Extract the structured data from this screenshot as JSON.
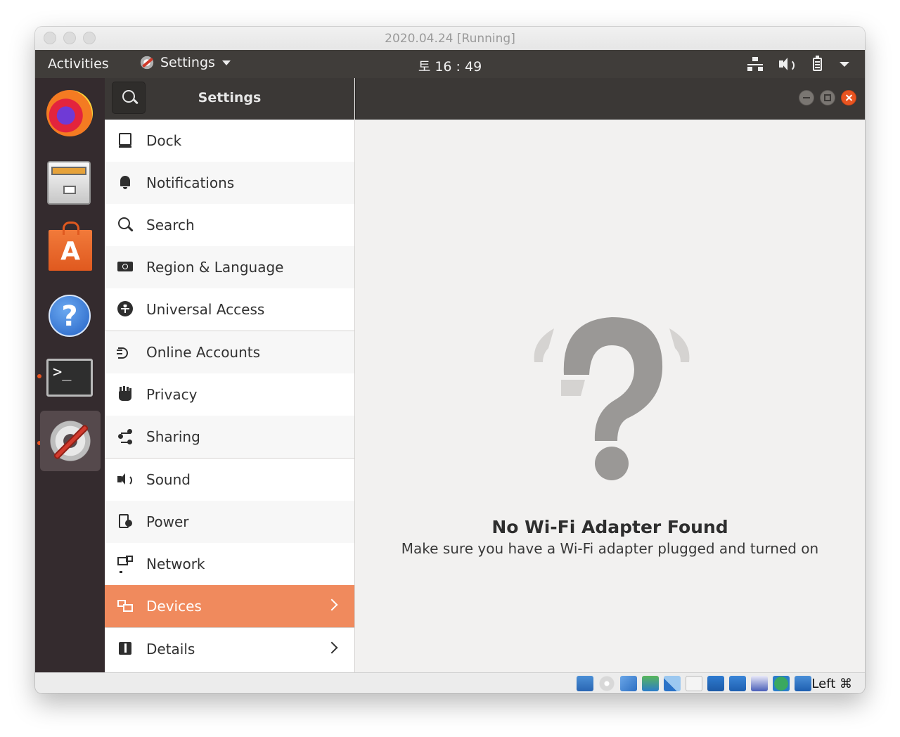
{
  "mac_window": {
    "title": "2020.04.24 [Running]"
  },
  "topbar": {
    "activities": "Activities",
    "app_menu": "Settings",
    "clock": "토 16 : 49",
    "tray_icons": [
      "network-icon",
      "volume-icon",
      "battery-icon",
      "system-menu-caret-icon"
    ]
  },
  "dock": {
    "apps": [
      {
        "name": "firefox-icon"
      },
      {
        "name": "files-icon"
      },
      {
        "name": "software-store-icon",
        "glyph": "A"
      },
      {
        "name": "help-icon",
        "glyph": "?"
      },
      {
        "name": "terminal-icon",
        "glyph": ">_"
      },
      {
        "name": "settings-icon"
      }
    ],
    "show_apps": "show-applications-icon"
  },
  "header": {
    "title": "Settings"
  },
  "sidebar": {
    "items": [
      {
        "label": "Dock",
        "icon": "dock-icon"
      },
      {
        "label": "Notifications",
        "icon": "bell-icon"
      },
      {
        "label": "Search",
        "icon": "search-icon"
      },
      {
        "label": "Region & Language",
        "icon": "region-icon"
      },
      {
        "label": "Universal Access",
        "icon": "universal-access-icon"
      },
      {
        "label": "Online Accounts",
        "icon": "online-accounts-icon"
      },
      {
        "label": "Privacy",
        "icon": "privacy-hand-icon"
      },
      {
        "label": "Sharing",
        "icon": "share-icon"
      },
      {
        "label": "Sound",
        "icon": "speaker-icon"
      },
      {
        "label": "Power",
        "icon": "power-icon"
      },
      {
        "label": "Network",
        "icon": "network-icon"
      },
      {
        "label": "Devices",
        "icon": "devices-icon",
        "selected": true
      },
      {
        "label": "Details",
        "icon": "details-icon"
      }
    ]
  },
  "content": {
    "empty_title": "No Wi-Fi Adapter Found",
    "empty_subtitle": "Make sure you have a Wi-Fi adapter plugged and turned on"
  },
  "vbox_status": {
    "host_key": "Left ⌘",
    "accent": "#e95420"
  }
}
